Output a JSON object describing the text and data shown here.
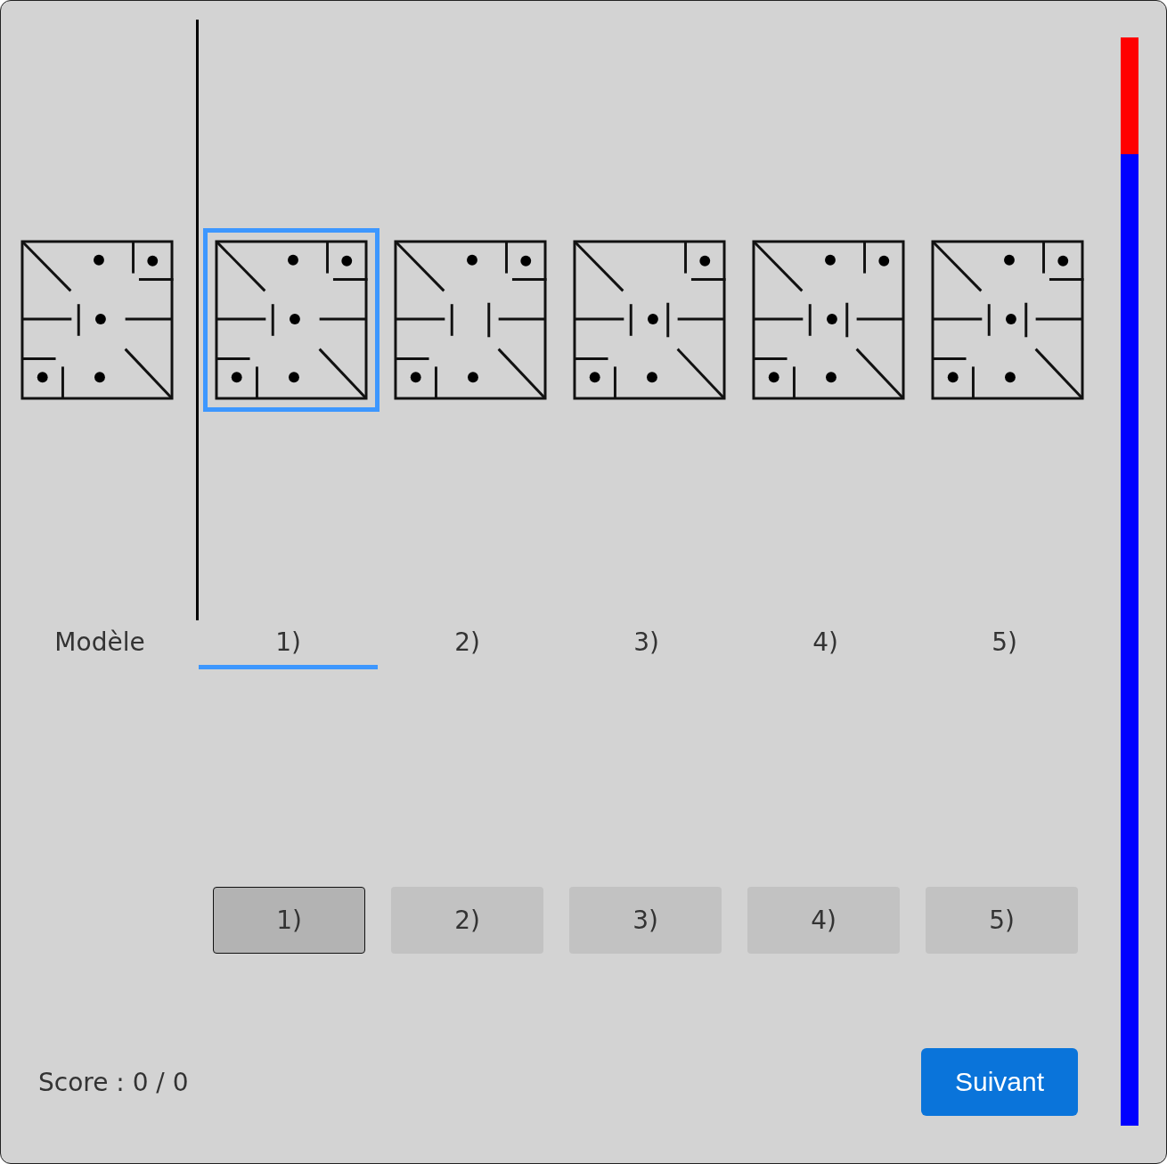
{
  "columns": [
    {
      "kind": "model",
      "label": "Modèle",
      "figure": {
        "top_dot": true,
        "center_dot": true,
        "corner_ledge": true,
        "right_bar": false
      }
    },
    {
      "kind": "option",
      "label": "1)",
      "selected": true,
      "figure": {
        "top_dot": true,
        "center_dot": true,
        "corner_ledge": true,
        "right_bar": false
      }
    },
    {
      "kind": "option",
      "label": "2)",
      "selected": false,
      "figure": {
        "top_dot": true,
        "center_dot": false,
        "corner_ledge": true,
        "right_bar": true
      }
    },
    {
      "kind": "option",
      "label": "3)",
      "selected": false,
      "figure": {
        "top_dot": false,
        "center_dot": true,
        "corner_ledge": true,
        "right_bar": true
      }
    },
    {
      "kind": "option",
      "label": "4)",
      "selected": false,
      "figure": {
        "top_dot": true,
        "center_dot": true,
        "corner_ledge": false,
        "right_bar": true
      }
    },
    {
      "kind": "option",
      "label": "5)",
      "selected": false,
      "figure": {
        "top_dot": true,
        "center_dot": true,
        "corner_ledge": true,
        "right_bar": true
      }
    }
  ],
  "answer_buttons": [
    {
      "label": "1)",
      "selected": true
    },
    {
      "label": "2)",
      "selected": false
    },
    {
      "label": "3)",
      "selected": false
    },
    {
      "label": "4)",
      "selected": false
    },
    {
      "label": "5)",
      "selected": false
    }
  ],
  "score": "Score : 0 / 0",
  "next_button": "Suivant",
  "timer": {
    "level": 0.107
  }
}
